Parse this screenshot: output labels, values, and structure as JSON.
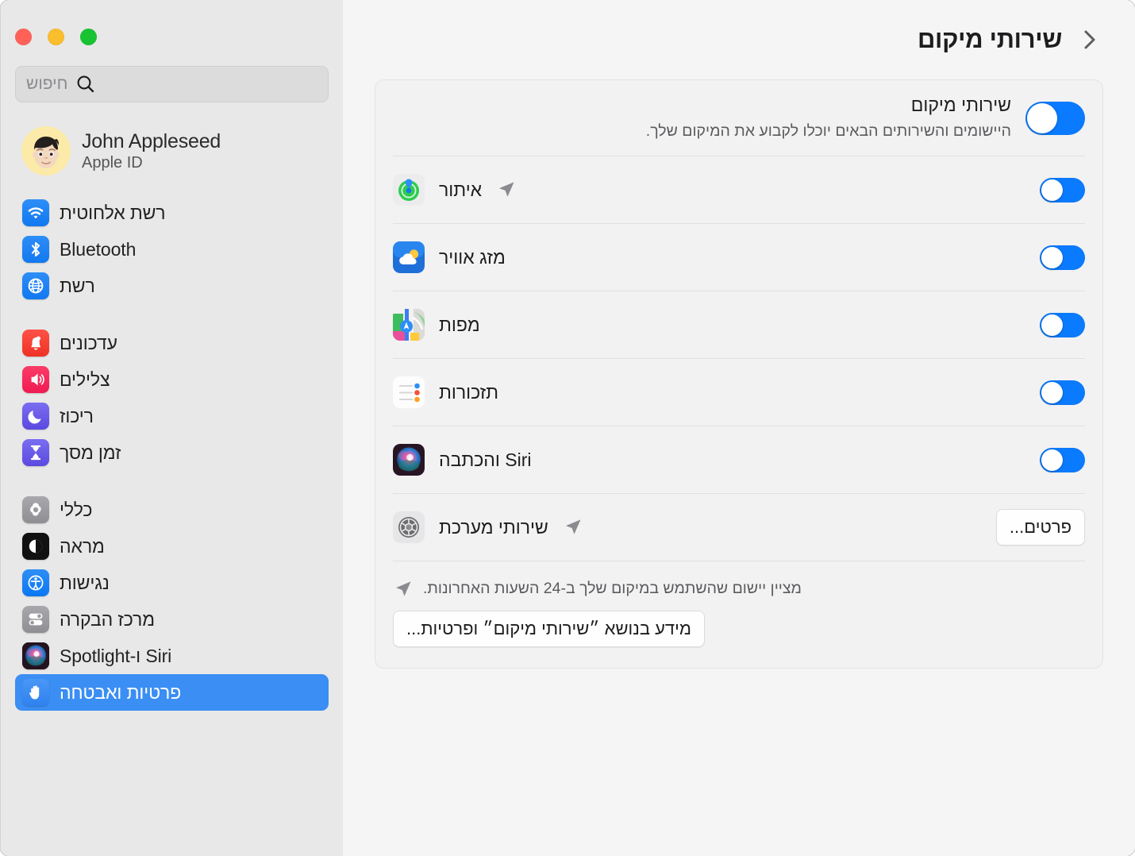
{
  "window": {
    "traffic_lights": [
      "close-button",
      "minimize-button",
      "maximize-button"
    ]
  },
  "sidebar": {
    "search": {
      "placeholder": "חיפוש",
      "icon": "search-icon"
    },
    "account": {
      "name": "John Appleseed",
      "subtitle": "Apple ID",
      "avatar": "memoji-avatar"
    },
    "groups": [
      {
        "items": [
          {
            "label": "רשת אלחוטית",
            "icon": "wifi-icon",
            "active": false
          },
          {
            "label": "Bluetooth",
            "icon": "bluetooth-icon",
            "active": false
          },
          {
            "label": "רשת",
            "icon": "network-globe-icon",
            "active": false
          }
        ]
      },
      {
        "items": [
          {
            "label": "עדכונים",
            "icon": "notifications-bell-icon",
            "active": false
          },
          {
            "label": "צלילים",
            "icon": "sound-speaker-icon",
            "active": false
          },
          {
            "label": "ריכוז",
            "icon": "focus-moon-icon",
            "active": false
          },
          {
            "label": "זמן מסך",
            "icon": "screen-time-hourglass-icon",
            "active": false
          }
        ]
      },
      {
        "items": [
          {
            "label": "כללי",
            "icon": "general-gear-icon",
            "active": false
          },
          {
            "label": "מראה",
            "icon": "appearance-contrast-icon",
            "active": false
          },
          {
            "label": "נגישות",
            "icon": "accessibility-icon",
            "active": false
          },
          {
            "label": "מרכז הבקרה",
            "icon": "control-center-icon",
            "active": false
          },
          {
            "label": "Siri ו-Spotlight",
            "icon": "siri-icon",
            "active": false
          },
          {
            "label": "פרטיות ואבטחה",
            "icon": "privacy-hand-icon",
            "active": true
          }
        ]
      }
    ]
  },
  "main": {
    "breadcrumb": {
      "title": "שירותי מיקום",
      "chevron": "chevron-forward-icon"
    },
    "master": {
      "title": "שירותי מיקום",
      "description": "היישומים והשירותים הבאים יוכלו לקבוע את המיקום שלך.",
      "enabled": true
    },
    "apps": [
      {
        "label": "איתור",
        "icon": "find-my-icon",
        "enabled": true,
        "recent_indicator": true,
        "control": "toggle"
      },
      {
        "label": "מזג אוויר",
        "icon": "weather-icon",
        "enabled": true,
        "recent_indicator": false,
        "control": "toggle"
      },
      {
        "label": "מפות",
        "icon": "maps-icon",
        "enabled": true,
        "recent_indicator": false,
        "control": "toggle"
      },
      {
        "label": "תזכורות",
        "icon": "reminders-icon",
        "enabled": true,
        "recent_indicator": false,
        "control": "toggle"
      },
      {
        "label": "Siri והכתבה",
        "icon": "siri-icon",
        "enabled": true,
        "recent_indicator": false,
        "control": "toggle"
      },
      {
        "label": "שירותי מערכת",
        "icon": "system-services-gear-icon",
        "enabled": null,
        "recent_indicator": true,
        "control": "button",
        "button_label": "פרטים..."
      }
    ],
    "footnote": {
      "icon": "location-arrow-icon",
      "text": "מציין יישום שהשתמש במיקום שלך ב-24 השעות האחרונות."
    },
    "info_button_label": "מידע בנושא ״שירותי מיקום״ ופרטיות..."
  },
  "colors": {
    "accent": "#0a7bff",
    "sidebar_selected": "#3b8ef3",
    "sidebar_bg": "#e8e8e8",
    "main_bg": "#f5f5f5",
    "card_bg": "#f2f2f2"
  }
}
